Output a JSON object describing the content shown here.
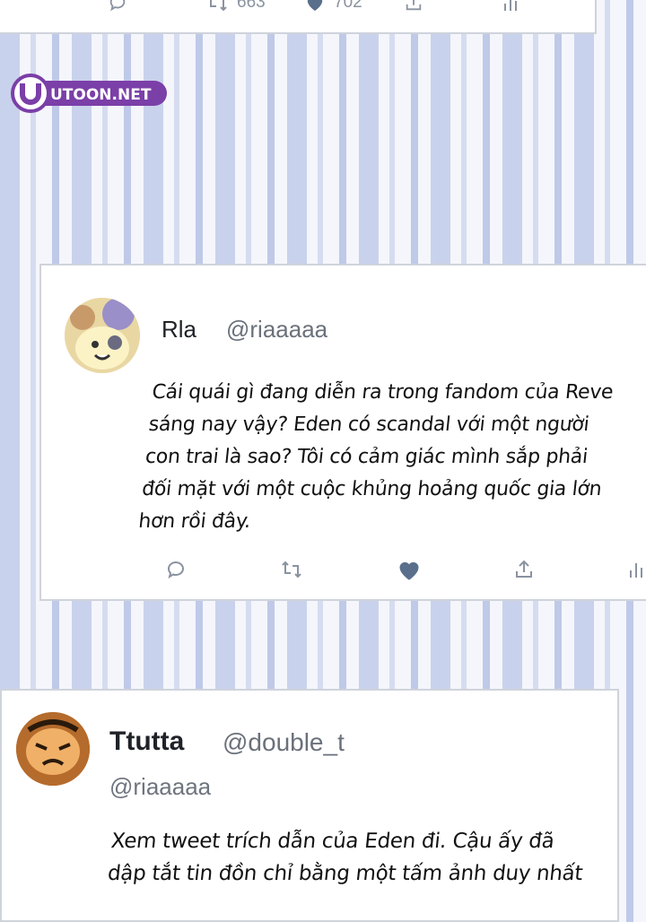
{
  "top_tweet": {
    "retweets": "663",
    "likes": "702"
  },
  "watermark": {
    "text": "UTOON.NET"
  },
  "tweet_rla": {
    "name": "Rla",
    "handle": "@riaaaaa",
    "text": "Cái quái gì đang diễn ra trong fandom của Reve sáng nay vậy? Eden có scandal với một người con trai là sao? Tôi có cảm giác mình sắp phải đối mặt với một cuộc khủng hoảng quốc gia lớn hơn rồi đây."
  },
  "tweet_ttutta": {
    "name": "Ttutta",
    "handle": "@double_t",
    "reply_to": "@riaaaaa",
    "text": "Xem tweet trích dẫn của Eden đi. Cậu ấy đã dập tắt tin đồn chỉ bằng một tấm ảnh duy nhất"
  },
  "colors": {
    "stripe": "#c9d2ec",
    "icon": "#8a93a0",
    "like_fill": "#5a6f8c",
    "logo_purple": "#7b3fa8"
  }
}
